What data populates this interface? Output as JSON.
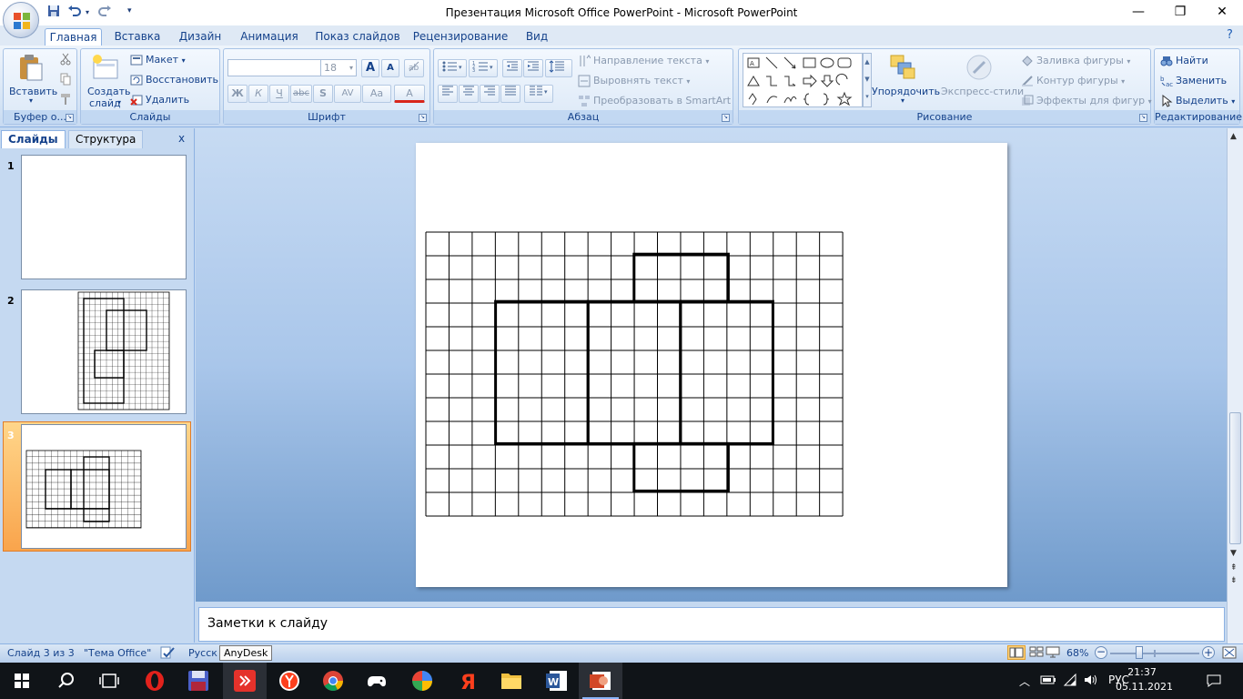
{
  "window": {
    "title": "Презентация Microsoft Office PowerPoint - Microsoft PowerPoint",
    "minimize": "—",
    "restore": "❐",
    "close": "✕"
  },
  "ribbon_tabs": [
    "Главная",
    "Вставка",
    "Дизайн",
    "Анимация",
    "Показ слайдов",
    "Рецензирование",
    "Вид"
  ],
  "clipboard": {
    "paste": "Вставить",
    "label": "Буфер о..."
  },
  "slides_group": {
    "new_slide": "Создать",
    "new_slide2": "слайд",
    "layout": "Макет",
    "reset": "Восстановить",
    "delete": "Удалить",
    "label": "Слайды"
  },
  "font_group": {
    "font_name": "",
    "font_size": "18",
    "bold": "Ж",
    "italic": "К",
    "underline": "Ч",
    "strike": "abc",
    "shadow": "S",
    "spacing": "AV",
    "case": "Aa",
    "color": "A",
    "grow": "A",
    "shrink": "A",
    "label": "Шрифт"
  },
  "paragraph_group": {
    "text_direction": "Направление текста",
    "align_text": "Выровнять текст",
    "smartart": "Преобразовать в SmartArt",
    "label": "Абзац"
  },
  "drawing_group": {
    "arrange": "Упорядочить",
    "quick_styles": "Экспресс-стили",
    "shape_fill": "Заливка фигуры",
    "shape_outline": "Контур фигуры",
    "shape_effects": "Эффекты для фигур",
    "label": "Рисование"
  },
  "editing_group": {
    "find": "Найти",
    "replace": "Заменить",
    "select": "Выделить",
    "label": "Редактирование"
  },
  "left_panel": {
    "tab_slides": "Слайды",
    "tab_outline": "Структура",
    "close": "x",
    "thumbs": [
      {
        "num": "1"
      },
      {
        "num": "2"
      },
      {
        "num": "3"
      }
    ]
  },
  "notes": {
    "placeholder": "Заметки к слайду"
  },
  "status": {
    "slide_info": "Слайд 3 из 3",
    "theme": "\"Тема Office\"",
    "language": "Русск",
    "tooltip": "AnyDesk",
    "zoom": "68%",
    "minus": "−",
    "plus": "+"
  },
  "taskbar": {
    "lang": "РУС",
    "time": "21:37",
    "date": "05.11.2021"
  }
}
